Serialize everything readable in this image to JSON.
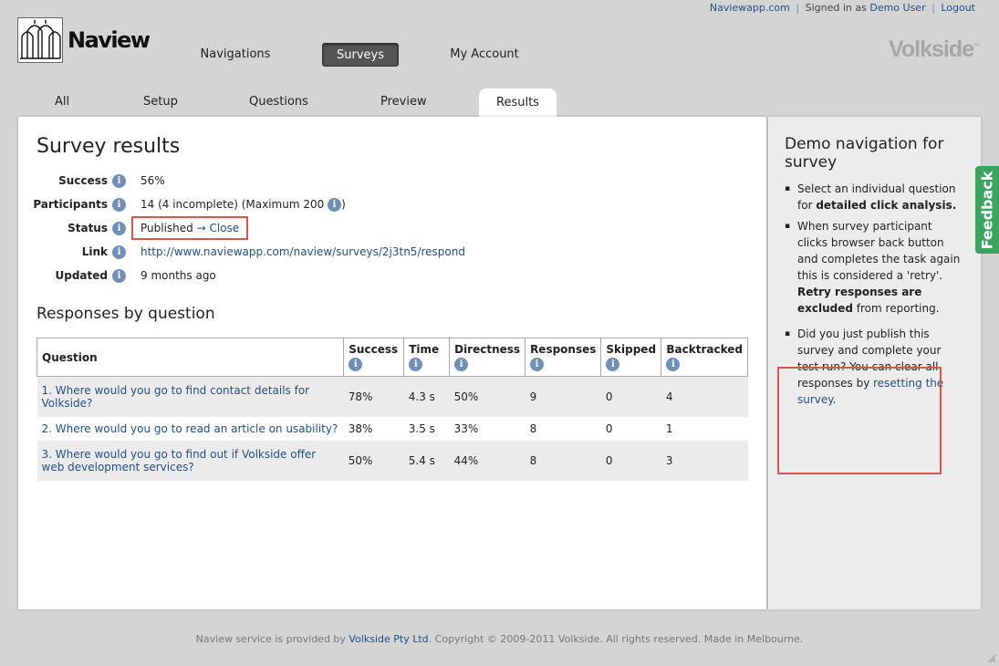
{
  "topbar": {
    "site_link": "Naviewapp.com",
    "signed_in_prefix": "Signed in as",
    "user": "Demo User",
    "logout": "Logout",
    "sep": "|"
  },
  "header": {
    "logo_text": "Naview",
    "brand": "Volkside",
    "brand_tm": "™"
  },
  "main_nav": [
    {
      "label": "Navigations"
    },
    {
      "label": "Surveys"
    },
    {
      "label": "My Account"
    }
  ],
  "sub_tabs": [
    {
      "label": "All"
    },
    {
      "label": "Setup"
    },
    {
      "label": "Questions"
    },
    {
      "label": "Preview"
    },
    {
      "label": "Results"
    }
  ],
  "survey": {
    "title": "Survey results",
    "success_label": "Success",
    "success_value": "56%",
    "participants_label": "Participants",
    "participants_value": "14 (4 incomplete) (Maximum 200",
    "participants_close": ")",
    "status_label": "Status",
    "status_value": "Published",
    "status_arrow": "→",
    "status_action": "Close",
    "link_label": "Link",
    "link_value": "http://www.naviewapp.com/naview/surveys/2j3tn5/respond",
    "updated_label": "Updated",
    "updated_value": "9 months ago"
  },
  "responses": {
    "title": "Responses by question",
    "columns": [
      "Question",
      "Success",
      "Time",
      "Directness",
      "Responses",
      "Skipped",
      "Backtracked"
    ],
    "rows": [
      {
        "question": "1. Where would you go to find contact details for Volkside?",
        "success": "78%",
        "time": "4.3 s",
        "directness": "50%",
        "responses": "9",
        "skipped": "0",
        "backtracked": "4"
      },
      {
        "question": "2. Where would you go to read an article on usability?",
        "success": "38%",
        "time": "3.5 s",
        "directness": "33%",
        "responses": "8",
        "skipped": "0",
        "backtracked": "1"
      },
      {
        "question": "3. Where would you go to find out if Volkside offer web development services?",
        "success": "50%",
        "time": "5.4 s",
        "directness": "44%",
        "responses": "8",
        "skipped": "0",
        "backtracked": "3"
      }
    ]
  },
  "sidebar": {
    "title": "Demo navigation for survey",
    "item1_a": "Select an individual question for ",
    "item1_b": "detailed click analysis.",
    "item2_a": "When survey participant clicks browser back button and completes the task again this is considered a 'retry'. ",
    "item2_b": "Retry responses are excluded",
    "item2_c": " from reporting.",
    "item3_a": "Did you just publish this survey and complete your test run? You can clear all responses by ",
    "item3_link": "resetting the survey",
    "item3_c": "."
  },
  "feedback": "Feedback",
  "footer": {
    "prefix": "Naview service is provided by",
    "company": "Volkside Pty Ltd",
    "suffix": ". Copyright © 2009-2011 Volkside. All rights reserved. Made in Melbourne."
  },
  "info_glyph": "i"
}
